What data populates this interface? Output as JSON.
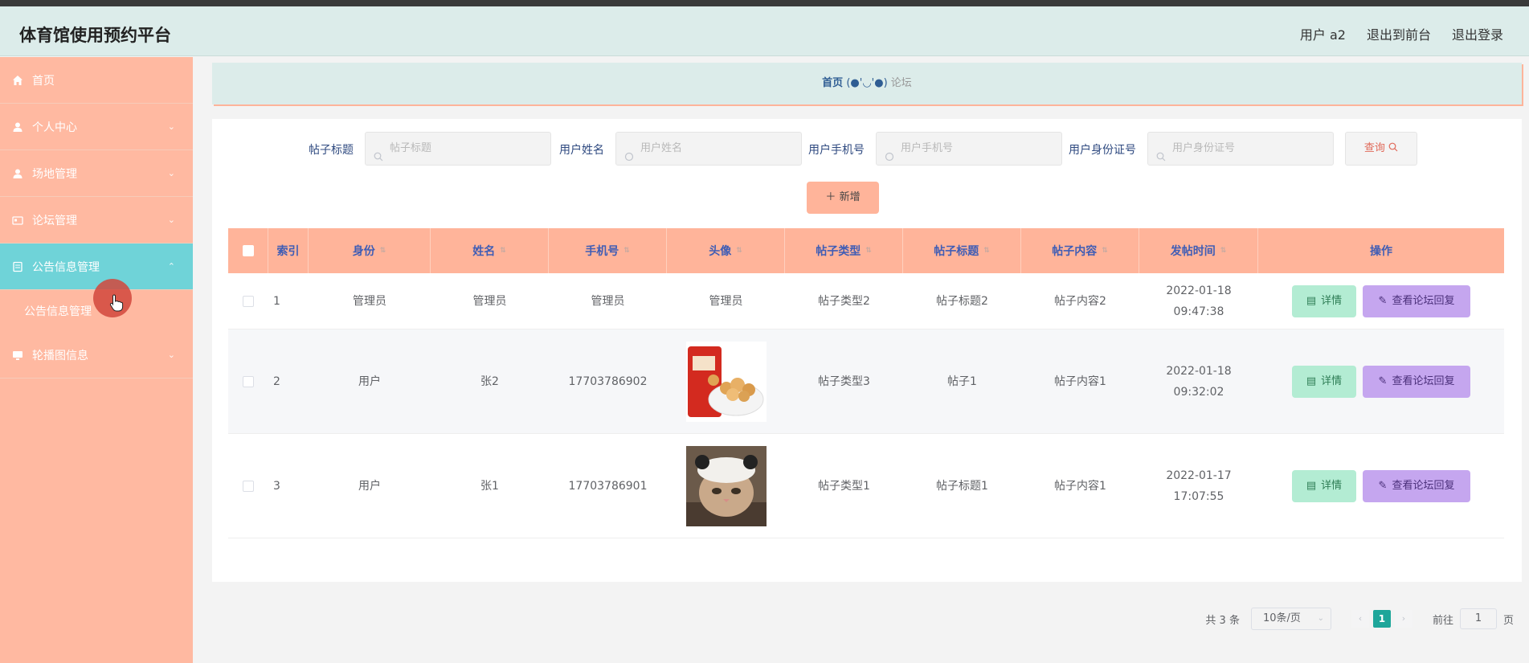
{
  "header": {
    "title": "体育馆使用预约平台",
    "user": "用户 a2",
    "to_front": "退出到前台",
    "logout": "退出登录"
  },
  "sidebar": {
    "items": [
      {
        "label": "首页",
        "icon": "home-icon"
      },
      {
        "label": "个人中心",
        "icon": "user-icon"
      },
      {
        "label": "场地管理",
        "icon": "user-icon"
      },
      {
        "label": "论坛管理",
        "icon": "card-icon"
      },
      {
        "label": "公告信息管理",
        "icon": "document-icon"
      },
      {
        "label": "轮播图信息",
        "icon": "monitor-icon"
      }
    ],
    "sub_item": "公告信息管理"
  },
  "breadcrumb": {
    "home": "首页",
    "face": "(●'◡'●)",
    "current": "论坛"
  },
  "search": {
    "title_label": "帖子标题",
    "title_placeholder": "帖子标题",
    "name_label": "用户姓名",
    "name_placeholder": "用户姓名",
    "phone_label": "用户手机号",
    "phone_placeholder": "用户手机号",
    "id_label": "用户身份证号",
    "id_placeholder": "用户身份证号",
    "query_button": "查询"
  },
  "toolbar": {
    "add_button": "新增"
  },
  "table": {
    "headers": [
      "索引",
      "身份",
      "姓名",
      "手机号",
      "头像",
      "帖子类型",
      "帖子标题",
      "帖子内容",
      "发帖时间",
      "操作"
    ],
    "rows": [
      {
        "index": "1",
        "identity": "管理员",
        "name": "管理员",
        "phone": "管理员",
        "avatar": "管理员",
        "type": "帖子类型2",
        "title": "帖子标题2",
        "content": "帖子内容2",
        "time": "2022-01-18 09:47:38"
      },
      {
        "index": "2",
        "identity": "用户",
        "name": "张2",
        "phone": "17703786902",
        "avatar": "",
        "type": "帖子类型3",
        "title": "帖子1",
        "content": "帖子内容1",
        "time": "2022-01-18 09:32:02"
      },
      {
        "index": "3",
        "identity": "用户",
        "name": "张1",
        "phone": "17703786901",
        "avatar": "",
        "type": "帖子类型1",
        "title": "帖子标题1",
        "content": "帖子内容1",
        "time": "2022-01-17 17:07:55"
      }
    ],
    "detail_button": "详情",
    "reply_button": "查看论坛回复"
  },
  "pagination": {
    "total": "共 3 条",
    "page_size": "10条/页",
    "current_page": "1",
    "goto_label": "前往",
    "goto_value": "1",
    "page_suffix": "页"
  }
}
